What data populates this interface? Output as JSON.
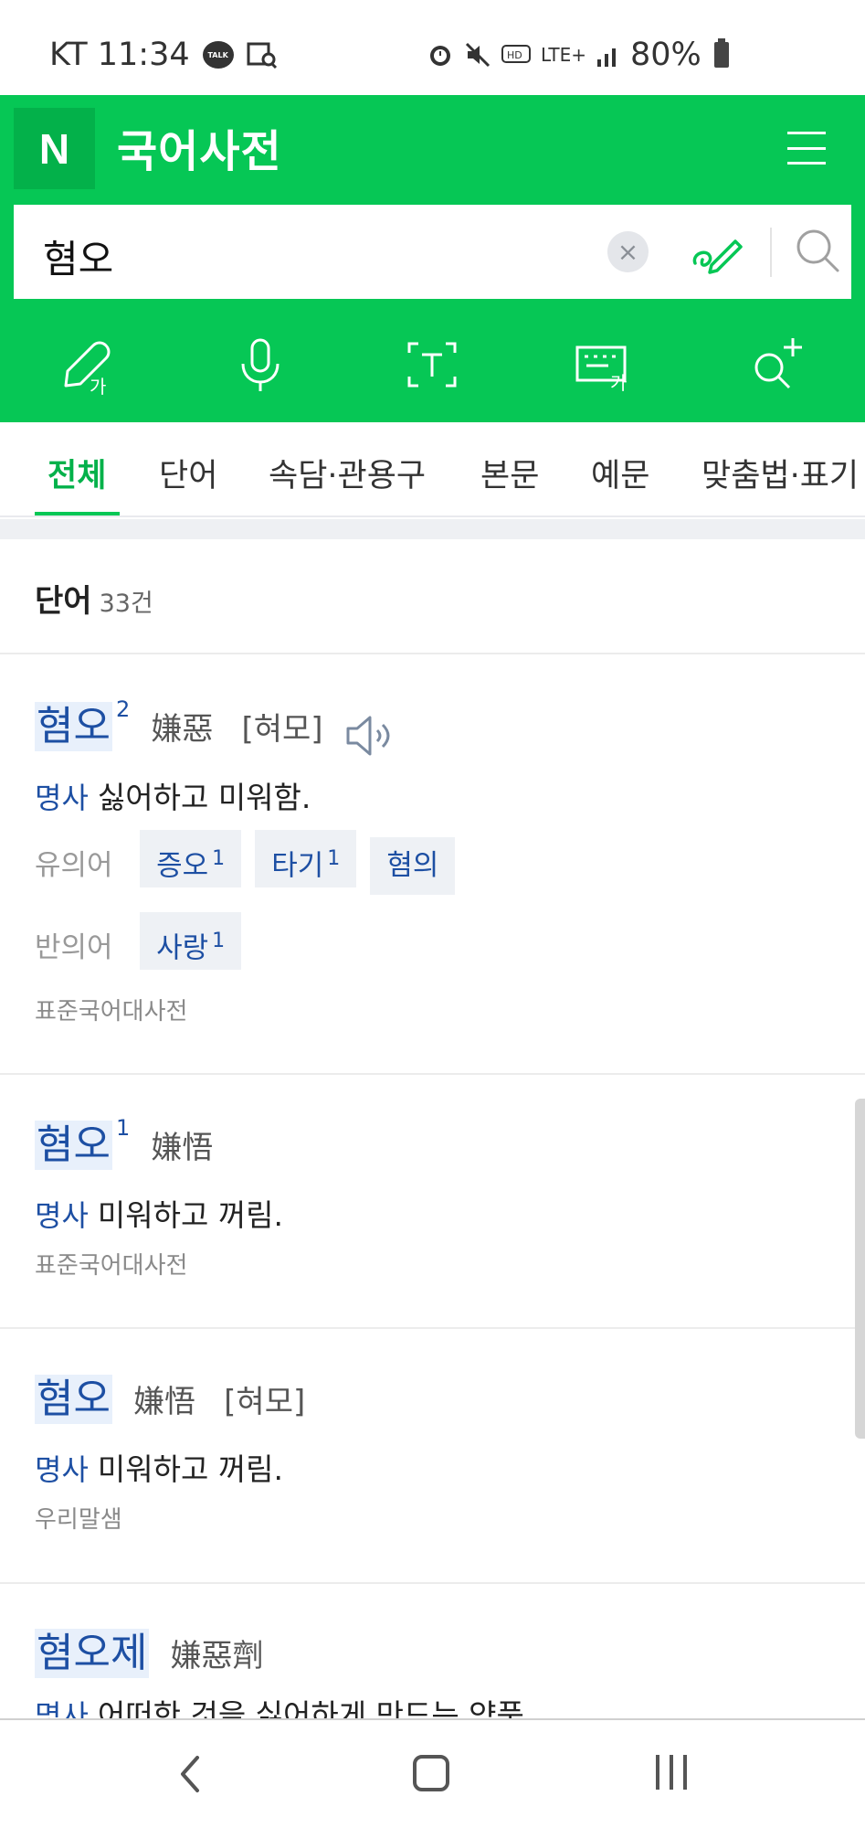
{
  "status_bar": {
    "carrier_time": "KT 11:34",
    "talk_badge": "TALK",
    "network": "LTE+",
    "battery": "80%"
  },
  "header": {
    "logo": "N",
    "title": "국어사전",
    "search_value": "혐오",
    "clear_symbol": "×"
  },
  "tabs": [
    "전체",
    "단어",
    "속담·관용구",
    "본문",
    "예문",
    "맞춤법·표기"
  ],
  "section": {
    "title": "단어",
    "count": "33건"
  },
  "entries": [
    {
      "headword": "혐오",
      "sup": "2",
      "hanja": "嫌惡",
      "pron": "[혀모]",
      "pos": "명사",
      "def": "싫어하고 미워함.",
      "synonym_label": "유의어",
      "synonyms": [
        {
          "text": "증오",
          "sup": "1"
        },
        {
          "text": "타기",
          "sup": "1"
        },
        {
          "text": "혐의",
          "sup": ""
        }
      ],
      "antonym_label": "반의어",
      "antonyms": [
        {
          "text": "사랑",
          "sup": "1"
        }
      ],
      "source": "표준국어대사전"
    },
    {
      "headword": "혐오",
      "sup": "1",
      "hanja": "嫌悟",
      "pos": "명사",
      "def": "미워하고 꺼림.",
      "source": "표준국어대사전"
    },
    {
      "headword": "혐오",
      "hanja": "嫌悟",
      "pron": "[혀모]",
      "pos": "명사",
      "def": "미워하고 꺼림.",
      "source": "우리말샘"
    },
    {
      "headword": "혐오제",
      "hanja": "嫌惡劑",
      "pos": "명사",
      "def": "어떠한 것을 싫어하게 만드는 약품."
    }
  ]
}
